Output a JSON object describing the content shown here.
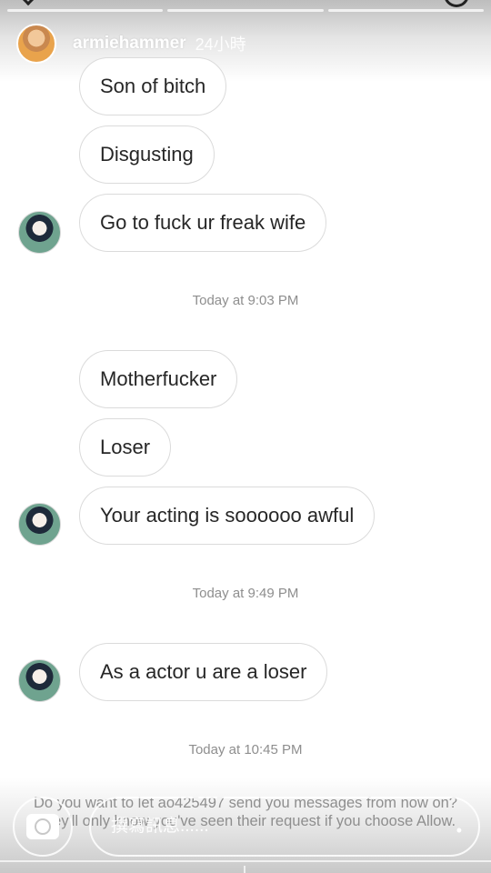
{
  "story": {
    "username": "armiehammer",
    "time_ago": "24小時"
  },
  "messages": {
    "m1": "Son of bitch",
    "m2": "Disgusting",
    "m3": "Go to fuck ur freak wife",
    "ts1": "Today at 9:03 PM",
    "m4": "Motherfucker",
    "m5": "Loser",
    "m6": "Your acting is soooooo awful",
    "ts2": "Today at 9:49 PM",
    "m7": "As a actor u are a loser",
    "ts3": "Today at 10:45 PM"
  },
  "request": {
    "line1": "Do you want to let ao425497 send you messages from now on?",
    "line2": "They'll only know you've seen their request if you choose Allow."
  },
  "reply": {
    "placeholder": "撰寫訊息......"
  },
  "icons": {
    "camera": "camera-icon",
    "avatar": "avatar"
  }
}
